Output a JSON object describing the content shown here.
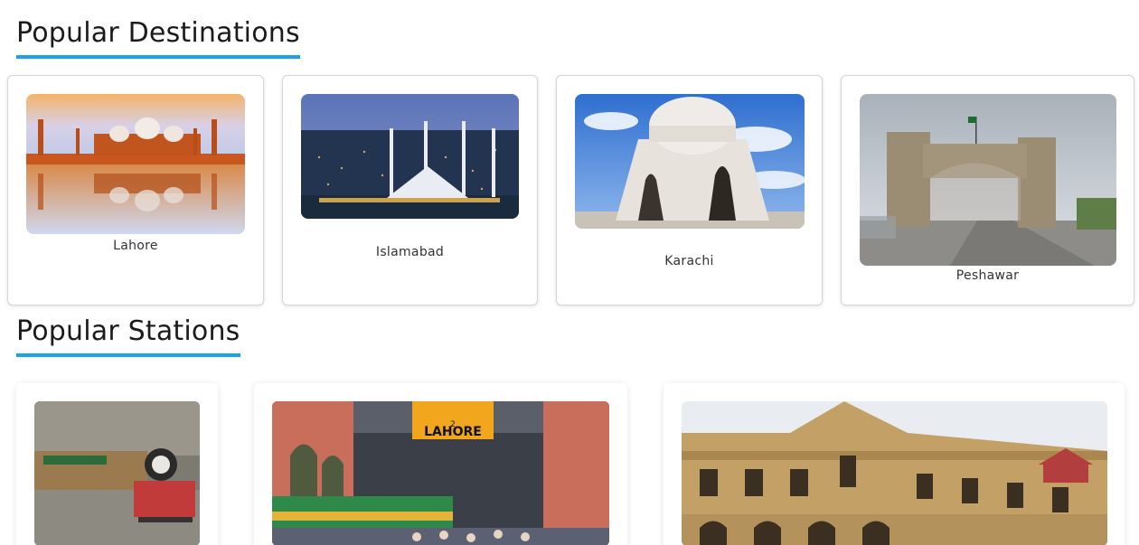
{
  "destinations": {
    "title": "Popular Destinations",
    "items": [
      {
        "label": "Lahore"
      },
      {
        "label": "Islamabad"
      },
      {
        "label": "Karachi"
      },
      {
        "label": "Peshawar"
      }
    ]
  },
  "stations": {
    "title": "Popular Stations",
    "sign_text": "LAHORE",
    "sign_number": "2"
  },
  "colors": {
    "accent_underline": "#1aa3e8",
    "card_border": "#d6d6d6"
  }
}
